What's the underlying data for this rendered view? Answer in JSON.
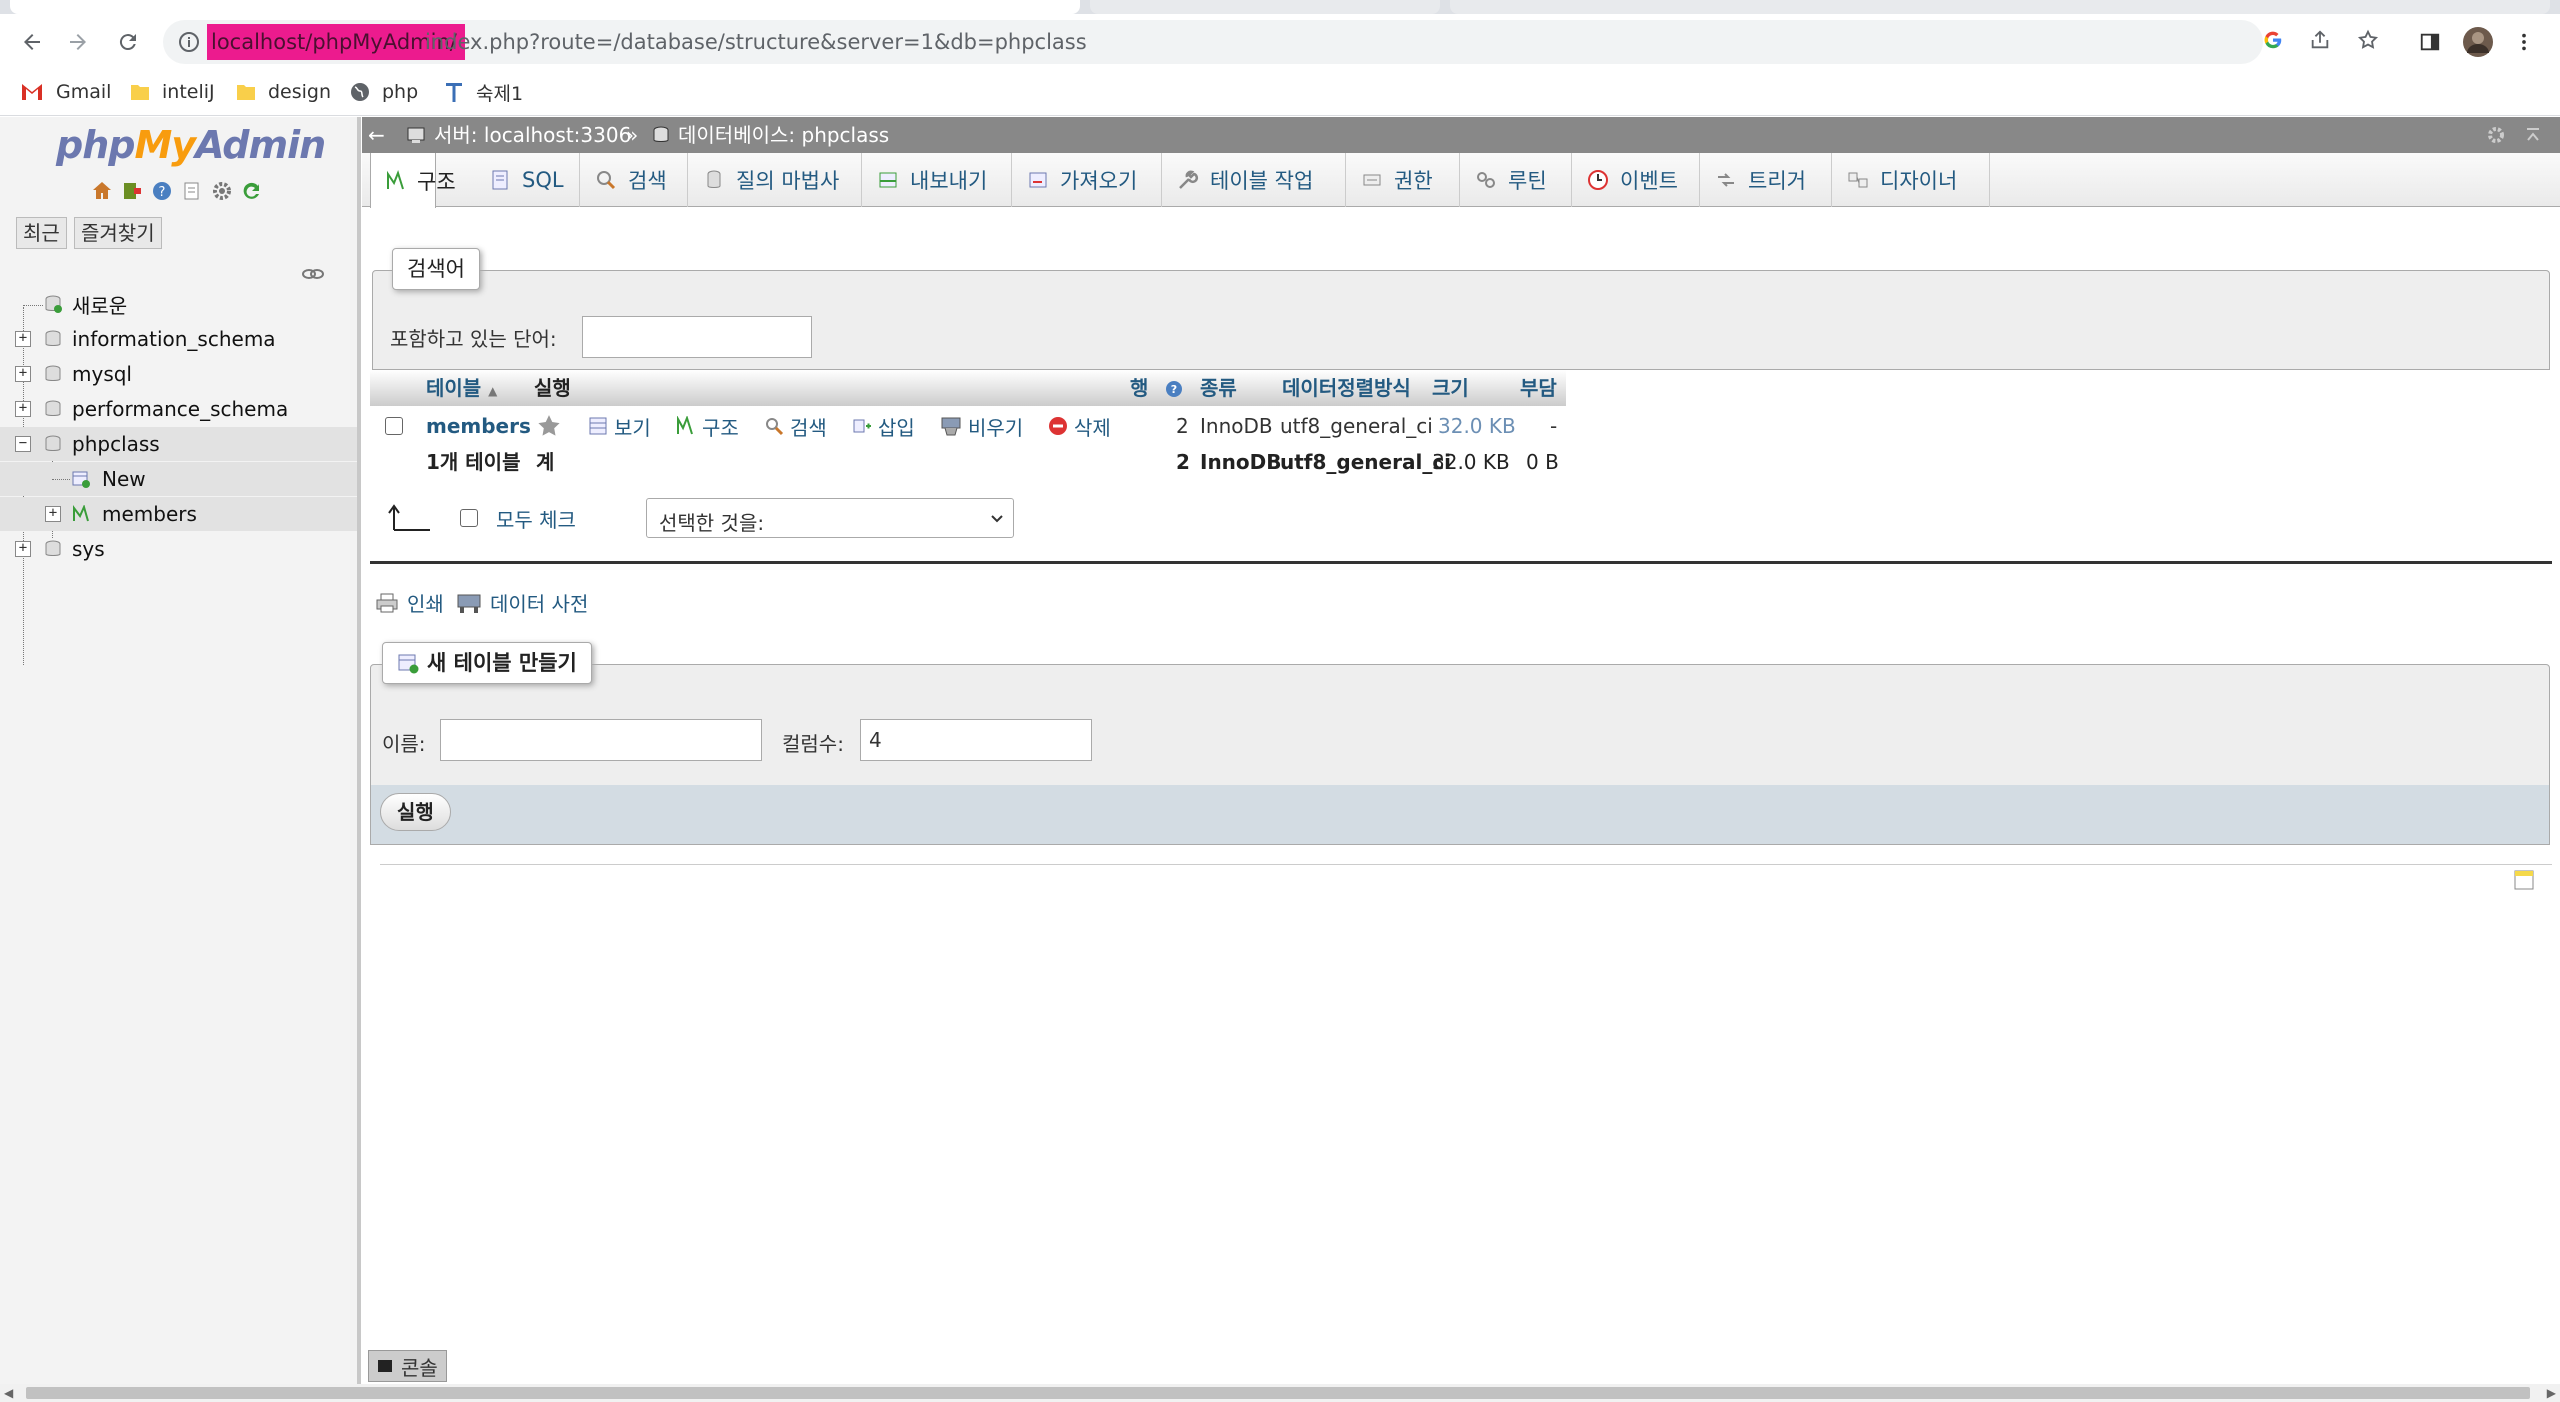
{
  "browser": {
    "url_highlighted": "localhost/phpMyAdmin/",
    "url_rest": "index.php?route=/database/structure&server=1&db=phpclass",
    "bookmarks": [
      {
        "label": "Gmail",
        "icon": "gmail-icon"
      },
      {
        "label": "inteliJ",
        "icon": "folder-icon"
      },
      {
        "label": "design",
        "icon": "folder-icon"
      },
      {
        "label": "php",
        "icon": "globe-icon"
      },
      {
        "label": "숙제1",
        "icon": "text-t-icon"
      }
    ]
  },
  "nav": {
    "logo": {
      "php": "php",
      "my": "My",
      "admin": "Admin"
    },
    "tabs": {
      "recent": "최근",
      "favorites": "즐겨찾기"
    },
    "tree": {
      "new": "새로운",
      "information_schema": "information_schema",
      "mysql": "mysql",
      "performance_schema": "performance_schema",
      "phpclass": "phpclass",
      "phpclass_new": "New",
      "phpclass_members": "members",
      "sys": "sys"
    }
  },
  "breadcrumb": {
    "server": "서버: localhost:3306",
    "separator": "»",
    "database": "데이터베이스: phpclass"
  },
  "menu": {
    "tabs": [
      "구조",
      "SQL",
      "검색",
      "질의 마법사",
      "내보내기",
      "가져오기",
      "테이블 작업",
      "권한",
      "루틴",
      "이벤트",
      "트리거",
      "디자이너"
    ],
    "active": "구조"
  },
  "filter": {
    "legend": "검색어",
    "label": "포함하고 있는 단어:",
    "value": ""
  },
  "table": {
    "headers": {
      "table": "테이블",
      "action": "실행",
      "rows": "행",
      "type": "종류",
      "collation": "데이터정렬방식",
      "size": "크기",
      "overhead": "부담"
    },
    "row": {
      "name": "members",
      "actions": [
        "보기",
        "구조",
        "검색",
        "삽입",
        "비우기",
        "삭제"
      ],
      "rows": "2",
      "engine": "InnoDB",
      "collation": "utf8_general_ci",
      "size": "32.0 KB",
      "overhead": "-"
    },
    "total": {
      "label": "1개 테이블",
      "sum": "계",
      "rows": "2",
      "engine": "InnoDB",
      "collation": "utf8_general_ci",
      "size": "32.0 KB",
      "overhead": "0 B"
    },
    "check_all": "모두 체크",
    "with_selected": "선택한 것을:"
  },
  "links": {
    "print": "인쇄",
    "data_dictionary": "데이터 사전"
  },
  "create_table": {
    "legend": "새 테이블 만들기",
    "name_label": "이름:",
    "name_value": "",
    "columns_label": "컬럼수:",
    "columns_value": "4",
    "go": "실행"
  },
  "console": "콘솔",
  "colors": {
    "link": "#235a81",
    "breadcrumb_bg": "#888888",
    "highlight": "#ec1b8e"
  }
}
